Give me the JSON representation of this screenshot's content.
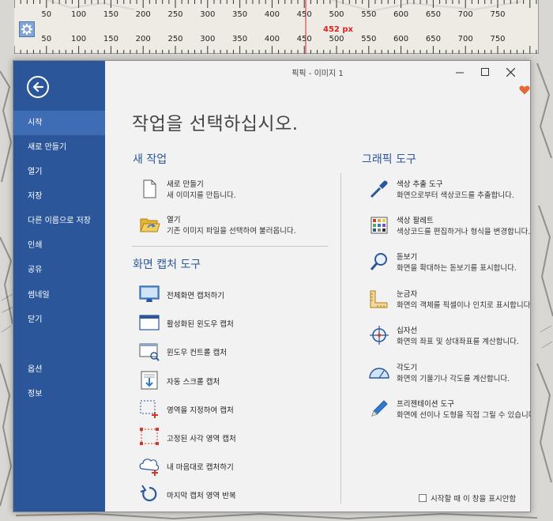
{
  "ruler": {
    "ticks_top": [
      "50",
      "100",
      "150",
      "200",
      "250",
      "300",
      "350",
      "400",
      "450",
      "500",
      "550",
      "600",
      "650",
      "700",
      "750"
    ],
    "ticks_bottom": [
      "50",
      "100",
      "150",
      "200",
      "250",
      "300",
      "350",
      "400",
      "450",
      "500",
      "550",
      "600",
      "650",
      "700",
      "750"
    ],
    "readout": "452 px"
  },
  "window": {
    "title": "픽픽 - 이미지 1",
    "buttons": {
      "minimize": "—",
      "maximize": "☐",
      "close": "✕"
    }
  },
  "sidebar": {
    "items": [
      {
        "label": "시작",
        "active": true
      },
      {
        "label": "새로 만들기"
      },
      {
        "label": "열기"
      },
      {
        "label": "저장"
      },
      {
        "label": "다른 이름으로 저장"
      },
      {
        "label": "인쇄"
      },
      {
        "label": "공유"
      },
      {
        "label": "썸네일"
      },
      {
        "label": "닫기"
      },
      {
        "label": "옵션"
      },
      {
        "label": "정보"
      }
    ]
  },
  "main": {
    "title": "작업을 선택하십시오.",
    "new_task": {
      "heading": "새 작업",
      "items": [
        {
          "label": "새로 만들기",
          "desc": "새 이미지를 만듭니다.",
          "icon": "blank-page-icon"
        },
        {
          "label": "열기",
          "desc": "기존 이미지 파일을 선택하여 불러옵니다.",
          "icon": "open-folder-icon"
        }
      ]
    },
    "capture": {
      "heading": "화면 캡처 도구",
      "items": [
        {
          "label": "전체화면 캡처하기",
          "icon": "monitor-icon"
        },
        {
          "label": "활성화된 윈도우 캡처",
          "icon": "active-window-icon"
        },
        {
          "label": "윈도우 컨트롤 캡처",
          "icon": "window-control-icon"
        },
        {
          "label": "자동 스크롤 캡처",
          "icon": "scroll-capture-icon"
        },
        {
          "label": "영역을 지정하여 캡처",
          "icon": "region-capture-icon"
        },
        {
          "label": "고정된 사각 영역 캡처",
          "icon": "fixed-region-icon"
        },
        {
          "label": "내 마음대로 캡처하기",
          "icon": "freehand-capture-icon"
        },
        {
          "label": "마지막 캡처 영역 반복",
          "icon": "repeat-capture-icon"
        }
      ]
    },
    "graphic": {
      "heading": "그래픽 도구",
      "items": [
        {
          "label": "색상 추출 도구",
          "desc": "화면으로부터 색상코드를 추출합니다.",
          "icon": "eyedropper-icon"
        },
        {
          "label": "색상 팔레트",
          "desc": "색상코드를 편집하거나 형식을 변경합니다.",
          "icon": "palette-icon"
        },
        {
          "label": "돋보기",
          "desc": "화면을 확대하는 돋보기를 표시합니다.",
          "icon": "magnifier-icon"
        },
        {
          "label": "눈금자",
          "desc": "화면의 객체를 픽셀이나 인치로 표시합니다.",
          "icon": "ruler-icon"
        },
        {
          "label": "십자선",
          "desc": "화면의 좌표 및 상대좌표를 계산합니다.",
          "icon": "crosshair-icon"
        },
        {
          "label": "각도기",
          "desc": "화면의 기울기나 각도를 계산합니다.",
          "icon": "protractor-icon"
        },
        {
          "label": "프리젠테이션 도구",
          "desc": "화면에 선이나 도형을 직접 그릴 수 있습니다.",
          "icon": "pen-icon"
        }
      ]
    },
    "startup_checkbox": "시작할 때 이 창을 표시안함"
  }
}
